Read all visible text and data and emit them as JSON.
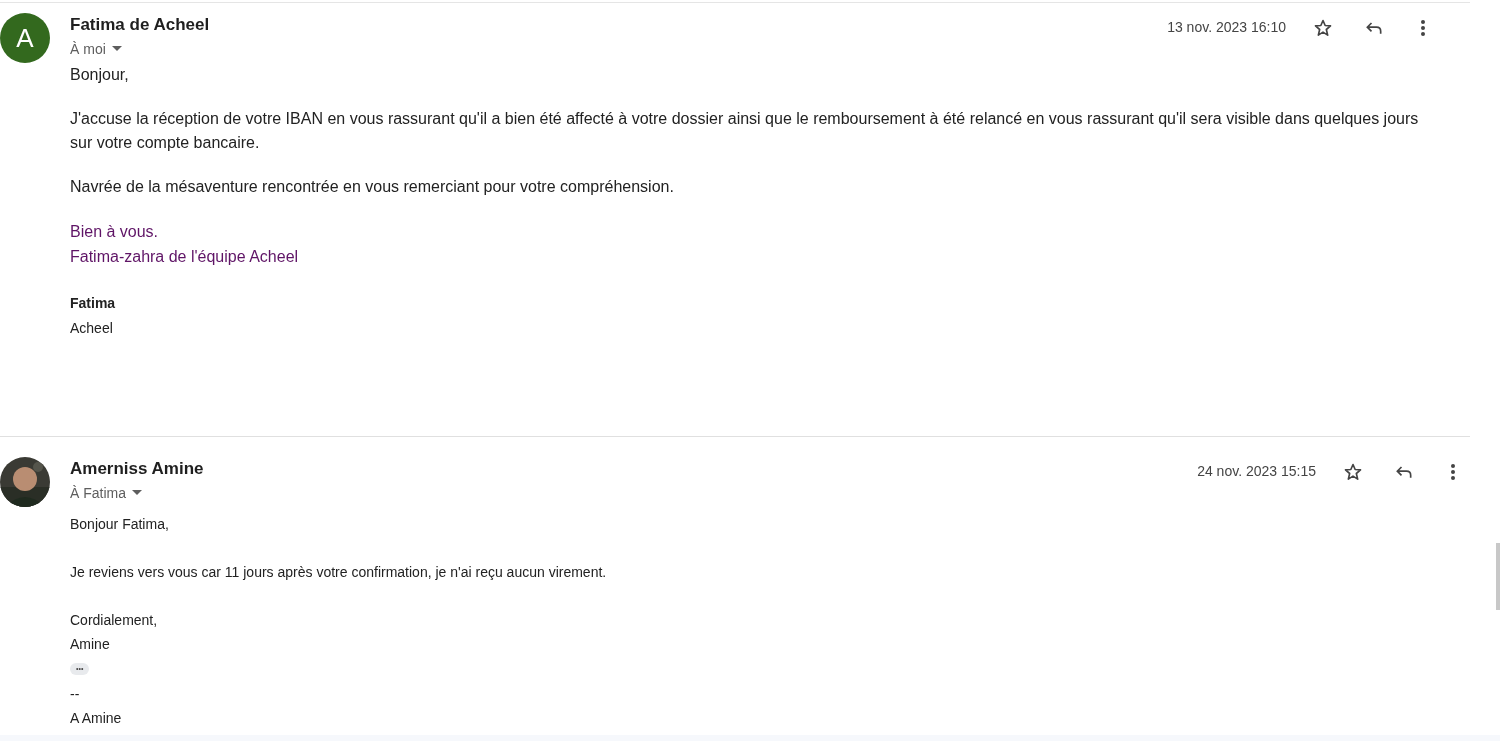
{
  "messages": [
    {
      "avatar": {
        "kind": "letter",
        "letter": "A",
        "color": "#33691e"
      },
      "sender": "Fatima de Acheel",
      "recipient": "À moi",
      "date": "13 nov. 2023 16:10",
      "starred": false,
      "kind": "formatted",
      "body": [
        {
          "kind": "paragraph",
          "text": "Bonjour,"
        },
        {
          "kind": "paragraph",
          "text": "J'accuse la réception de votre IBAN en vous rassurant qu'il a bien été affecté à votre dossier ainsi que le remboursement à été relancé en vous rassurant qu'il sera visible dans quelques jours sur votre compte bancaire."
        },
        {
          "kind": "paragraph",
          "text": "Navrée de la mésaventure rencontrée en vous remerciant pour votre compréhension."
        },
        {
          "kind": "closing",
          "lines": [
            "Bien à vous.",
            "Fatima-zahra de l'équipe Acheel"
          ]
        },
        {
          "kind": "signature",
          "name": "Fatima",
          "company": "Acheel"
        }
      ]
    },
    {
      "sender": "Amerniss Amine",
      "recipient": "À Fatima",
      "date": "24 nov. 2023 15:15",
      "starred": false,
      "kind": "plain",
      "body": [
        {
          "kind": "paragraph",
          "text": "Bonjour Fatima,"
        },
        {
          "kind": "paragraph",
          "text": "Je reviens vers vous car 11 jours après votre confirmation, je n'ai reçu aucun virement."
        },
        {
          "kind": "line",
          "text": "Cordialement,"
        },
        {
          "kind": "line",
          "text": "Amine"
        },
        {
          "kind": "ellipsis",
          "text": "•••"
        },
        {
          "kind": "line",
          "text": "--"
        },
        {
          "kind": "line",
          "text": "A Amine"
        }
      ]
    }
  ]
}
